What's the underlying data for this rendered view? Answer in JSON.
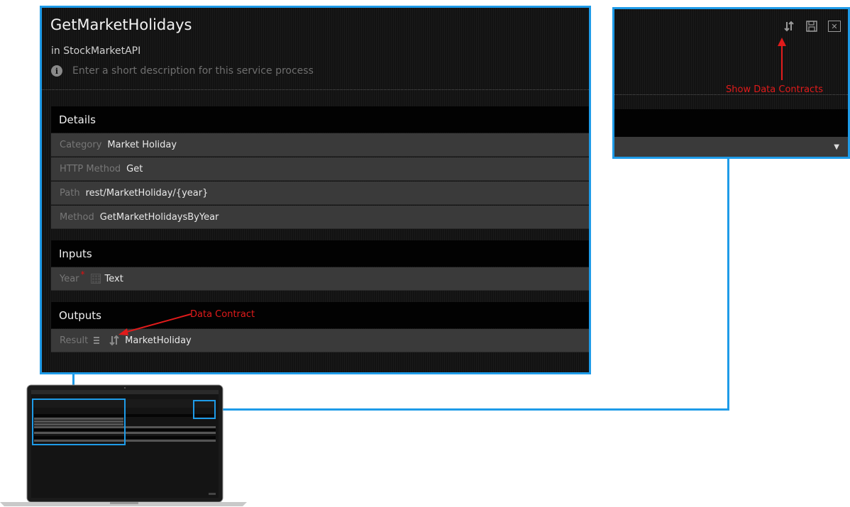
{
  "panel": {
    "title": "GetMarketHolidays",
    "subtitle": "in StockMarketAPI",
    "description_placeholder": "Enter a short description for this service process"
  },
  "details": {
    "header": "Details",
    "rows": [
      {
        "label": "Category",
        "value": "Market Holiday"
      },
      {
        "label": "HTTP Method",
        "value": "Get"
      },
      {
        "label": "Path",
        "value": "rest/MarketHoliday/{year}"
      },
      {
        "label": "Method",
        "value": "GetMarketHolidaysByYear"
      }
    ]
  },
  "inputs": {
    "header": "Inputs",
    "row": {
      "label": "Year",
      "required_mark": "*",
      "type": "Text"
    }
  },
  "outputs": {
    "header": "Outputs",
    "row": {
      "label": "Result",
      "type": "MarketHoliday"
    }
  },
  "annotations": {
    "data_contract": "Data Contract",
    "show_data_contracts": "Show Data Contracts"
  },
  "side_panel": {
    "icons": [
      "data-contract-icon",
      "save-icon",
      "close-icon"
    ]
  },
  "colors": {
    "highlight_blue": "#1e9be8",
    "annotation_red": "#e11b1b"
  }
}
